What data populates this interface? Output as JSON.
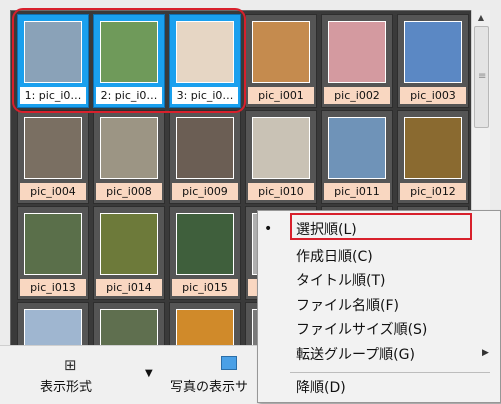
{
  "gallery": {
    "tiles": [
      {
        "label": "1: pic_i0…",
        "selected": true
      },
      {
        "label": "2: pic_i0…",
        "selected": true
      },
      {
        "label": "3: pic_i0…",
        "selected": true
      },
      {
        "label": "pic_i001",
        "selected": false
      },
      {
        "label": "pic_i002",
        "selected": false
      },
      {
        "label": "pic_i003",
        "selected": false
      },
      {
        "label": "pic_i004",
        "selected": false
      },
      {
        "label": "pic_i008",
        "selected": false
      },
      {
        "label": "pic_i009",
        "selected": false
      },
      {
        "label": "pic_i010",
        "selected": false
      },
      {
        "label": "pic_i011",
        "selected": false
      },
      {
        "label": "pic_i012",
        "selected": false
      },
      {
        "label": "pic_i013",
        "selected": false
      },
      {
        "label": "pic_i014",
        "selected": false
      },
      {
        "label": "pic_i015",
        "selected": false
      },
      {
        "label": "",
        "selected": false
      },
      {
        "label": "",
        "selected": false
      },
      {
        "label": "",
        "selected": false
      },
      {
        "label": "",
        "selected": false
      },
      {
        "label": "",
        "selected": false
      },
      {
        "label": "",
        "selected": false
      },
      {
        "label": "",
        "selected": false
      },
      {
        "label": "",
        "selected": false
      },
      {
        "label": "",
        "selected": false
      }
    ]
  },
  "toolbar": {
    "view_mode_label": "表示形式",
    "photo_view_label": "写真の表示サ"
  },
  "context_menu": {
    "items": [
      {
        "label": "選択順(L)",
        "checked": true
      },
      {
        "label": "作成日順(C)"
      },
      {
        "label": "タイトル順(T)"
      },
      {
        "label": "ファイル名順(F)"
      },
      {
        "label": "ファイルサイズ順(S)"
      },
      {
        "label": "転送グループ順(G)",
        "has_submenu": true
      },
      {
        "label": "降順(D)"
      }
    ]
  },
  "colors": {
    "gallery_bg": "#3a3a3a",
    "tile_bg": "#555555",
    "selected_tile": "#1aa0ee",
    "label_bg": "#f9d7c1",
    "highlight_red": "#d8202c",
    "menu_bg": "#f2f2f2"
  }
}
